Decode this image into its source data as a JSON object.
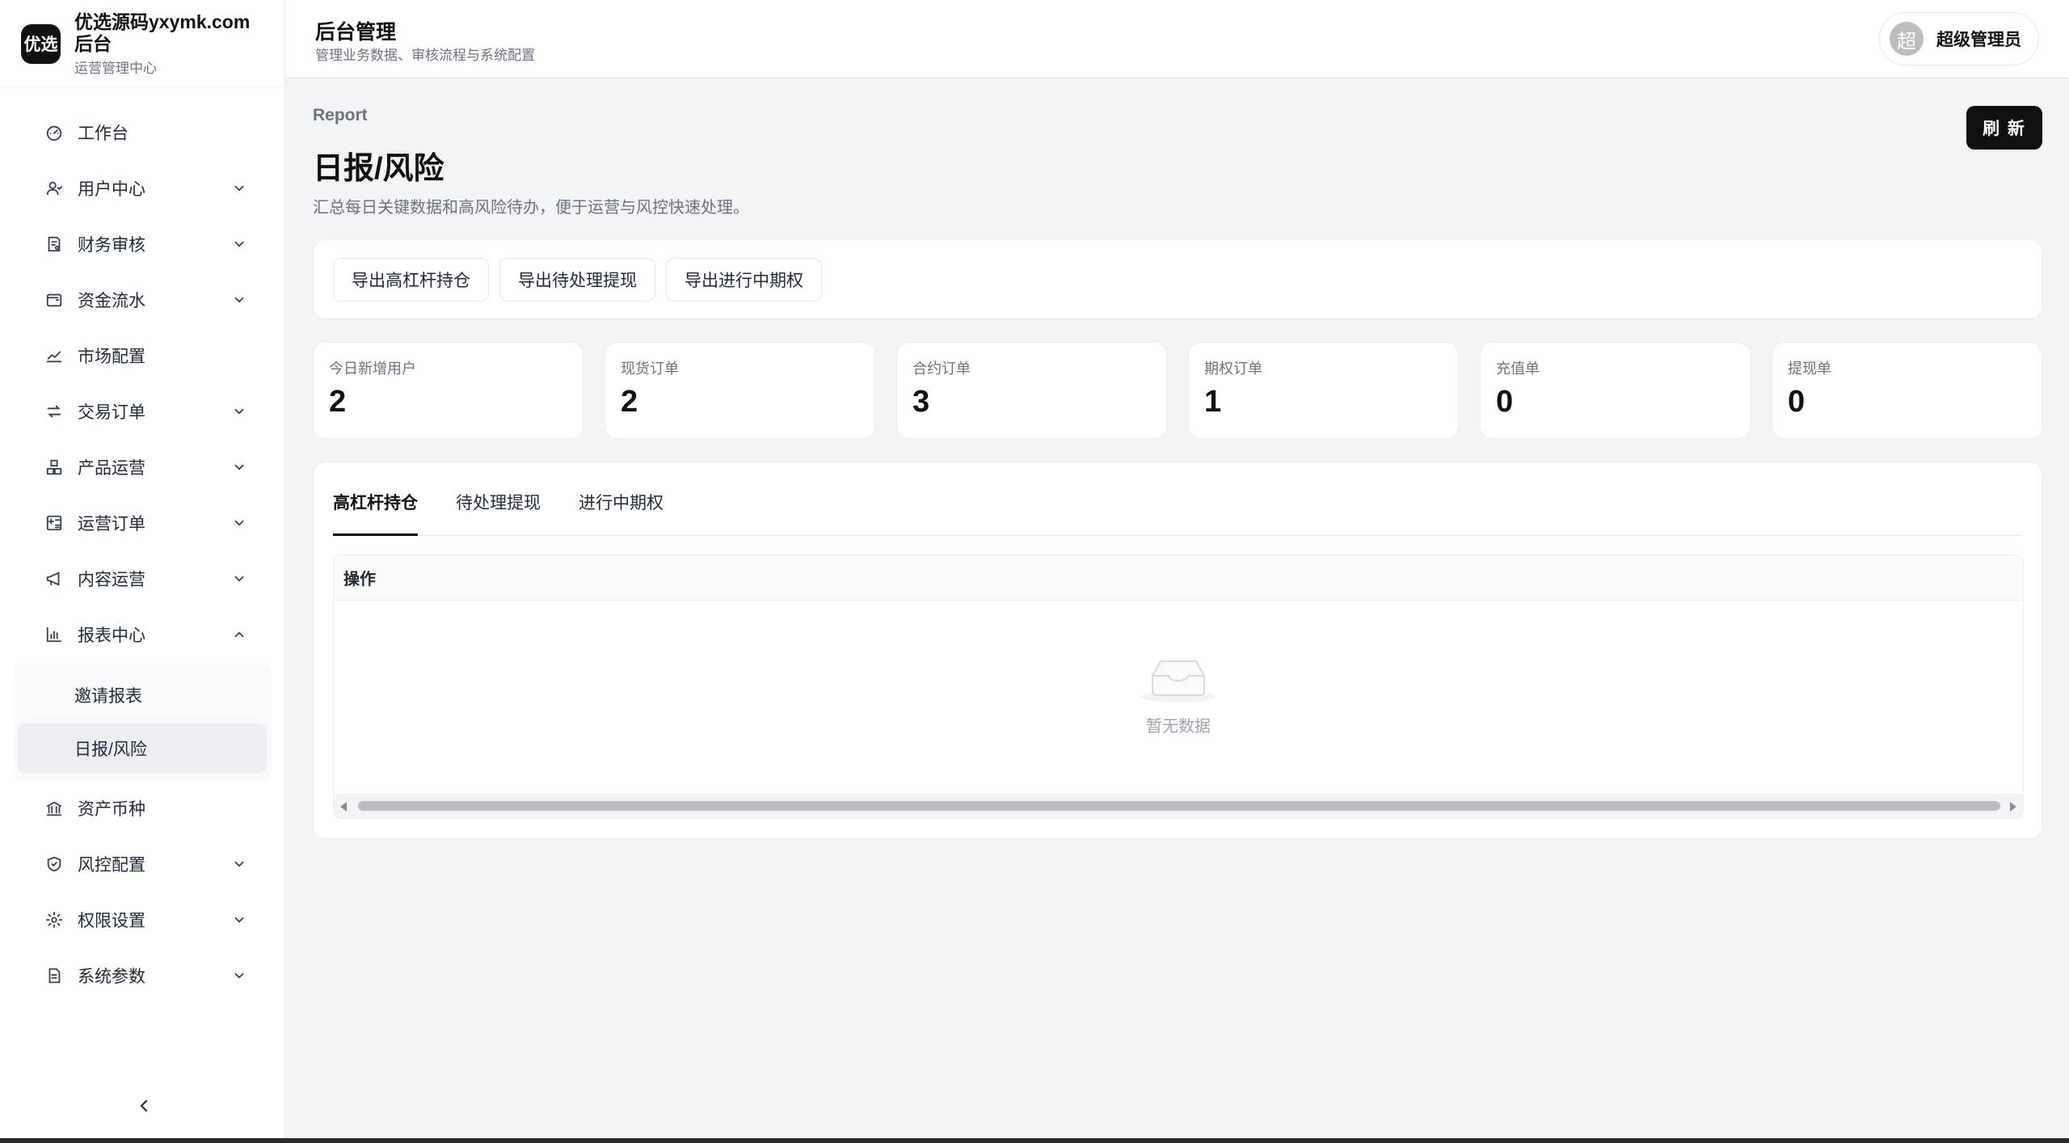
{
  "brand": {
    "logo_text": "优选",
    "name": "优选源码yxymk.com后台",
    "subtitle": "运营管理中心"
  },
  "header": {
    "title": "后台管理",
    "subtitle": "管理业务数据、审核流程与系统配置"
  },
  "user": {
    "avatar_text": "超",
    "name": "超级管理员"
  },
  "sidebar": {
    "items": [
      {
        "label": "工作台",
        "icon": "dashboard-icon",
        "expandable": false
      },
      {
        "label": "用户中心",
        "icon": "user-icon",
        "expandable": true
      },
      {
        "label": "财务审核",
        "icon": "receipt-icon",
        "expandable": true
      },
      {
        "label": "资金流水",
        "icon": "wallet-icon",
        "expandable": true
      },
      {
        "label": "市场配置",
        "icon": "chart-line-icon",
        "expandable": false
      },
      {
        "label": "交易订单",
        "icon": "swap-icon",
        "expandable": true
      },
      {
        "label": "产品运营",
        "icon": "boxes-icon",
        "expandable": true
      },
      {
        "label": "运营订单",
        "icon": "calculator-icon",
        "expandable": true
      },
      {
        "label": "内容运营",
        "icon": "megaphone-icon",
        "expandable": true
      },
      {
        "label": "报表中心",
        "icon": "bar-chart-icon",
        "expandable": true,
        "expanded": true
      },
      {
        "label": "资产币种",
        "icon": "bank-icon",
        "expandable": false
      },
      {
        "label": "风控配置",
        "icon": "shield-icon",
        "expandable": true
      },
      {
        "label": "权限设置",
        "icon": "gear-icon",
        "expandable": true
      },
      {
        "label": "系统参数",
        "icon": "document-icon",
        "expandable": true
      }
    ],
    "report_children": [
      {
        "label": "邀请报表",
        "active": false
      },
      {
        "label": "日报/风险",
        "active": true
      }
    ]
  },
  "page": {
    "eyebrow": "Report",
    "title": "日报/风险",
    "description": "汇总每日关键数据和高风险待办，便于运营与风控快速处理。",
    "refresh_label": "刷 新"
  },
  "exports": [
    "导出高杠杆持仓",
    "导出待处理提现",
    "导出进行中期权"
  ],
  "stats": [
    {
      "label": "今日新增用户",
      "value": "2"
    },
    {
      "label": "现货订单",
      "value": "2"
    },
    {
      "label": "合约订单",
      "value": "3"
    },
    {
      "label": "期权订单",
      "value": "1"
    },
    {
      "label": "充值单",
      "value": "0"
    },
    {
      "label": "提现单",
      "value": "0"
    }
  ],
  "tabs": [
    {
      "label": "高杠杆持仓",
      "active": true
    },
    {
      "label": "待处理提现",
      "active": false
    },
    {
      "label": "进行中期权",
      "active": false
    }
  ],
  "table": {
    "columns": [
      "操作"
    ],
    "empty_text": "暂无数据"
  }
}
